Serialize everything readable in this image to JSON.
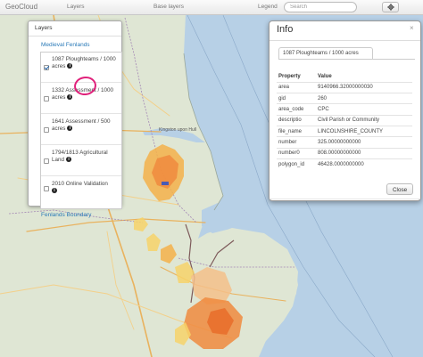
{
  "navbar": {
    "brand": "GeoCloud",
    "menu_layers": "Layers",
    "menu_base_layers": "Base layers",
    "legend_label": "Legend",
    "search_placeholder": "Search",
    "locate_icon": "crosshair-icon"
  },
  "layers_panel": {
    "title": "Layers",
    "group_title": "Medieval Fenlands",
    "items": [
      {
        "label": "1087 Ploughteams / 1000 acres",
        "checked": true
      },
      {
        "label": "1332 Assessment / 1000 acres",
        "checked": false
      },
      {
        "label": "1641 Assessment / 500 acres",
        "checked": false
      },
      {
        "label": "1794/1813 Agricultural Land",
        "checked": false
      },
      {
        "label": "2010 Online Validation",
        "checked": false
      }
    ],
    "footer_group": "Fenlands Boundary",
    "info_icon": "info-icon",
    "annotation_color": "#e0207a"
  },
  "map": {
    "place_label": "Kingston upon Hull",
    "colors": {
      "sea": "#b7d0e6",
      "land": "#dfe6d4",
      "heat_high": "#f08a3e",
      "heat_mid": "#f5b04a",
      "heat_low": "#f7d26a"
    }
  },
  "info_panel": {
    "title": "Info",
    "tab_label": "1087 Ploughteams / 1000 acres",
    "columns": [
      "Property",
      "Value"
    ],
    "rows": [
      [
        "area",
        "9140966.32000000030"
      ],
      [
        "gid",
        "260"
      ],
      [
        "area_code",
        "CPC"
      ],
      [
        "descriptio",
        "Civil Parish or Community"
      ],
      [
        "file_name",
        "LINCOLNSHIRE_COUNTY"
      ],
      [
        "number",
        "325.00000000000"
      ],
      [
        "number0",
        "808.00000000000"
      ],
      [
        "polygon_id",
        "46428.0000000000"
      ]
    ],
    "close_label": "Close"
  }
}
